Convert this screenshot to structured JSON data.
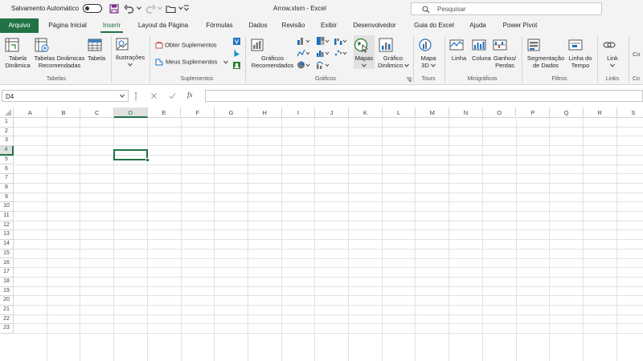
{
  "titlebar": {
    "autosave_label": "Salvamento Automático",
    "autosave_state": "off",
    "title": "Arrow.xlsm  -  Excel",
    "search_placeholder": "Pesquisar"
  },
  "tabs": [
    "Arquivo",
    "Página Inicial",
    "Inserir",
    "Layout da Página",
    "Fórmulas",
    "Dados",
    "Revisão",
    "Exibir",
    "Desenvolvedor",
    "Guia do Excel",
    "Ajuda",
    "Power Pivot"
  ],
  "active_tab": "Inserir",
  "ribbon": {
    "tabelas": {
      "group_label": "Tabelas",
      "pivot_table": [
        "Tabela",
        "Dinâmica"
      ],
      "recommended_pivot": [
        "Tabelas Dinâmicas",
        "Recomendadas"
      ],
      "table": "Tabela"
    },
    "ilustracoes": {
      "label": "Ilustrações"
    },
    "suplementos": {
      "group_label": "Suplementos",
      "get_addins": "Obter Suplementos",
      "my_addins": "Meus Suplementos"
    },
    "graficos": {
      "group_label": "Gráficos",
      "recommended": [
        "Gráficos",
        "Recomendados"
      ],
      "maps": "Mapas",
      "pivot_chart": [
        "Gráfico",
        "Dinâmico"
      ]
    },
    "tours": {
      "group_label": "Tours",
      "map3d": [
        "Mapa",
        "3D"
      ]
    },
    "minigraficos": {
      "group_label": "Minigráficos",
      "line": "Linha",
      "column": "Coluna",
      "winloss": [
        "Ganhos/",
        "Perdas"
      ]
    },
    "filtros": {
      "group_label": "Filtros",
      "slicer": [
        "Segmentação",
        "de Dados"
      ],
      "timeline": [
        "Linha do",
        "Tempo"
      ]
    },
    "links": {
      "group_label": "Links",
      "link": "Link"
    }
  },
  "formula_bar": {
    "name_box": "D4",
    "fx": "fx",
    "value": ""
  },
  "grid": {
    "columns": [
      "A",
      "B",
      "C",
      "D",
      "E",
      "F",
      "G",
      "H",
      "I",
      "J",
      "K",
      "L",
      "M",
      "N",
      "O",
      "P",
      "Q",
      "R",
      "S"
    ],
    "rows": [
      "1",
      "2",
      "3",
      "4",
      "5",
      "6",
      "7",
      "8",
      "9",
      "10",
      "11",
      "12",
      "13",
      "14",
      "15",
      "16",
      "17",
      "18",
      "19",
      "20",
      "21",
      "22",
      "23"
    ],
    "selected_cell": "D4"
  },
  "colors": {
    "accent": "#217346",
    "chrome": "#f3f3f3"
  }
}
